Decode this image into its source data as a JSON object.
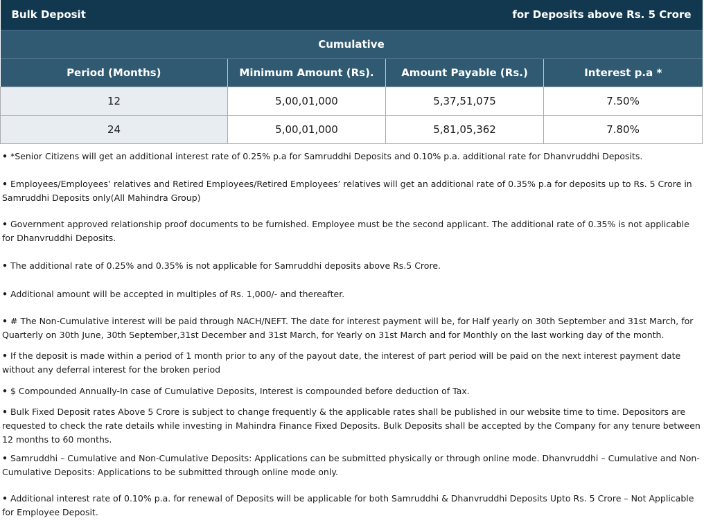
{
  "header": {
    "title": "Bulk Deposit",
    "subtitle": "for Deposits above Rs. 5 Crore",
    "category": "Cumulative"
  },
  "table": {
    "columns": [
      "Period (Months)",
      "Minimum Amount (Rs).",
      "Amount Payable (Rs.)",
      "Interest p.a *"
    ],
    "rows": [
      [
        "12",
        "5,00,01,000",
        "5,37,51,075",
        "7.50%"
      ],
      [
        "24",
        "5,00,01,000",
        "5,81,05,362",
        "7.80%"
      ]
    ]
  },
  "notes": [
    "*Senior Citizens will get an additional interest rate of 0.25% p.a for Samruddhi Deposits and 0.10% p.a. additional rate for Dhanvruddhi Deposits.",
    "Employees/Employees’ relatives and Retired Employees/Retired Employees’ relatives will get an additional rate of 0.35% p.a for deposits up to Rs. 5 Crore in Samruddhi Deposits only(All Mahindra Group)",
    "Government approved relationship proof documents to be furnished. Employee must be the second applicant. The additional rate of 0.35% is not applicable for Dhanvruddhi Deposits.",
    "The additional rate of 0.25% and 0.35% is not applicable for Samruddhi deposits above Rs.5 Crore.",
    "Additional amount will be accepted in multiples of Rs. 1,000/- and thereafter.",
    "# The Non-Cumulative interest will be paid through NACH/NEFT. The date for interest payment will be, for Half yearly on 30th September and 31st March, for Quarterly on 30th June, 30th September,31st December and 31st March, for Yearly on 31st March and for Monthly on the last working day of the month.",
    "If the deposit is made within a period of 1 month prior to any of the payout date, the interest of part period will be paid on the next interest payment date without any deferral interest for the broken period",
    "$ Compounded Annually-In case of Cumulative Deposits, Interest is compounded before deduction of Tax.",
    "Bulk Fixed Deposit rates Above 5 Crore is subject to change frequently & the applicable rates shall be published in our website time to time. Depositors are requested to check the rate details while investing in Mahindra Finance Fixed Deposits. Bulk Deposits shall be accepted by the Company for any tenure between 12 months to 60 months.",
    "Samruddhi – Cumulative and Non-Cumulative Deposits: Applications can be submitted physically or through online mode. Dhanvruddhi – Cumulative and Non-Cumulative Deposits: Applications to be submitted through online mode only.",
    "Additional interest rate of 0.10% p.a. for renewal of Deposits will be applicable for both Samruddhi & Dhanvruddhi Deposits Upto Rs. 5 Crore – Not Applicable for Employee Deposit."
  ]
}
